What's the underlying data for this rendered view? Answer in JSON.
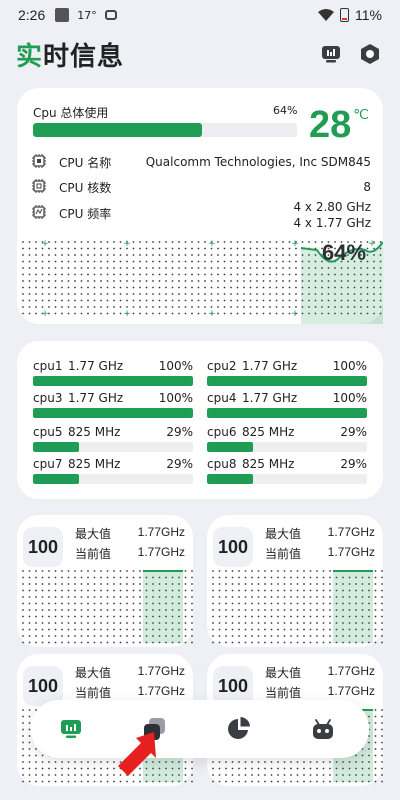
{
  "status_bar": {
    "time": "2:26",
    "temp": "17°",
    "battery": "11%"
  },
  "header": {
    "title_accent": "实",
    "title_rest": "时信息"
  },
  "cpu": {
    "usage_label": "Cpu 总体使用",
    "usage_text": "64%",
    "usage_value": 64,
    "temperature": "28",
    "temperature_unit": "℃",
    "name_label": "CPU 名称",
    "name_value": "Qualcomm Technologies, Inc SDM845",
    "cores_label": "CPU 核数",
    "cores_value": "8",
    "freq_label": "CPU 频率",
    "freq_line1": "4 x 2.80 GHz",
    "freq_line2": "4 x 1.77 GHz",
    "graph_pct": "64%"
  },
  "cores": [
    {
      "name": "cpu1",
      "freq": "1.77 GHz",
      "pct": "100%",
      "value": 100
    },
    {
      "name": "cpu2",
      "freq": "1.77 GHz",
      "pct": "100%",
      "value": 100
    },
    {
      "name": "cpu3",
      "freq": "1.77 GHz",
      "pct": "100%",
      "value": 100
    },
    {
      "name": "cpu4",
      "freq": "1.77 GHz",
      "pct": "100%",
      "value": 100
    },
    {
      "name": "cpu5",
      "freq": "825 MHz",
      "pct": "29%",
      "value": 29
    },
    {
      "name": "cpu6",
      "freq": "825 MHz",
      "pct": "29%",
      "value": 29
    },
    {
      "name": "cpu7",
      "freq": "825 MHz",
      "pct": "29%",
      "value": 29
    },
    {
      "name": "cpu8",
      "freq": "825 MHz",
      "pct": "29%",
      "value": 29
    }
  ],
  "mini_cards": [
    {
      "badge": "100",
      "max_label": "最大值",
      "max_value": "1.77GHz",
      "cur_label": "当前值",
      "cur_value": "1.77GHz"
    },
    {
      "badge": "100",
      "max_label": "最大值",
      "max_value": "1.77GHz",
      "cur_label": "当前值",
      "cur_value": "1.77GHz"
    },
    {
      "badge": "100",
      "max_label": "最大值",
      "max_value": "1.77GHz",
      "cur_label": "当前值",
      "cur_value": "1.77GHz"
    },
    {
      "badge": "100",
      "max_label": "最大值",
      "max_value": "1.77GHz",
      "cur_label": "当前值",
      "cur_value": "1.77GHz"
    }
  ],
  "nav": {
    "items": [
      "monitor-icon",
      "layers-icon",
      "pie-chart-icon",
      "android-robot-icon"
    ],
    "active": 0
  },
  "colors": {
    "accent": "#1f9d55",
    "background": "#eef0f5",
    "card": "#ffffff"
  }
}
